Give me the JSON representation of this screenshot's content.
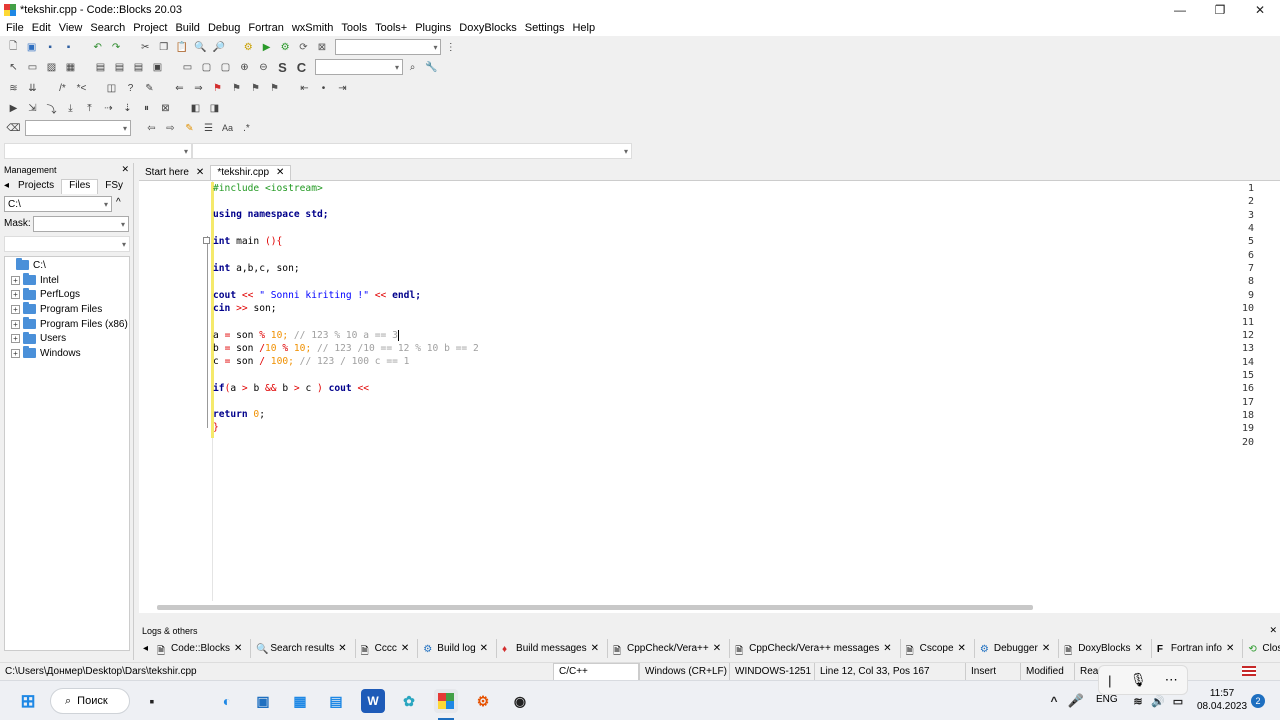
{
  "window": {
    "title": "*tekshir.cpp - Code::Blocks 20.03"
  },
  "menu": [
    "File",
    "Edit",
    "View",
    "Search",
    "Project",
    "Build",
    "Debug",
    "Fortran",
    "wxSmith",
    "Tools",
    "Tools+",
    "Plugins",
    "DoxyBlocks",
    "Settings",
    "Help"
  ],
  "management": {
    "title": "Management",
    "tabs": [
      "Projects",
      "Files",
      "FSy"
    ],
    "path": "C:\\",
    "mask_label": "Mask:",
    "tree": [
      "C:\\",
      "Intel",
      "PerfLogs",
      "Program Files",
      "Program Files (x86)",
      "Users",
      "Windows"
    ]
  },
  "editor": {
    "tabs": [
      "Start here",
      "*tekshir.cpp"
    ],
    "line_numbers": [
      "1",
      "2",
      "3",
      "4",
      "5",
      "6",
      "7",
      "8",
      "9",
      "10",
      "11",
      "12",
      "13",
      "14",
      "15",
      "16",
      "17",
      "18",
      "19",
      "20"
    ]
  },
  "code": {
    "l1": "#include <iostream>",
    "l3_kw": "using namespace",
    "l3_rest": " std;",
    "l5_kw": "int",
    "l5_rest": " main ",
    "l5_op": "(){",
    "l7_kw": "int",
    "l7_rest": " a,b,c, son;",
    "l9_a": "cout ",
    "l9_op1": "<<",
    "l9_str": " \" Sonni kiriting !\" ",
    "l9_op2": "<<",
    "l9_b": " endl;",
    "l10_a": "cin ",
    "l10_op": ">>",
    "l10_b": " son;",
    "l12_a": "a ",
    "l12_op1": "=",
    "l12_b": " son ",
    "l12_op2": "%",
    "l12_num": " 10;",
    "l12_cmt": " // 123 % 10 a == 3",
    "l13_a": "b ",
    "l13_op1": "=",
    "l13_b": " son ",
    "l13_op2": "/",
    "l13_n1": "10 ",
    "l13_op3": "%",
    "l13_n2": " 10;",
    "l13_cmt": " // 123 /10 == 12 % 10 b == 2",
    "l14_a": "c ",
    "l14_op1": "=",
    "l14_b": " son ",
    "l14_op2": "/",
    "l14_num": " 100;",
    "l14_cmt": " // 123 / 100 c == 1",
    "l16_kw": "if",
    "l16_op1": "(",
    "l16_a": "a ",
    "l16_op2": ">",
    "l16_b": " b ",
    "l16_op3": "&&",
    "l16_c": " b ",
    "l16_op4": ">",
    "l16_d": " c ",
    "l16_op5": ")",
    "l16_e": " cout ",
    "l16_op6": "<<",
    "l18_kw": "return",
    "l18_num": " 0",
    "l18_rest": ";",
    "l19": "}"
  },
  "logs": {
    "title": "Logs & others",
    "tabs": [
      "Code::Blocks",
      "Search results",
      "Cccc",
      "Build log",
      "Build messages",
      "CppCheck/Vera++",
      "CppCheck/Vera++ messages",
      "Cscope",
      "Debugger",
      "DoxyBlocks",
      "Fortran info",
      "Close"
    ]
  },
  "status": {
    "path": "C:\\Users\\Донмер\\Desktop\\Dars\\tekshir.cpp",
    "lang": "C/C++",
    "eol": "Windows (CR+LF)",
    "encoding": "WINDOWS-1251",
    "position": "Line 12, Col 33, Pos 167",
    "mode": "Insert",
    "modified": "Modified",
    "access": "Read/"
  },
  "taskbar": {
    "search_label": "Поиск",
    "lang": "ENG",
    "time": "11:57",
    "date": "08.04.2023",
    "badge": "2"
  }
}
